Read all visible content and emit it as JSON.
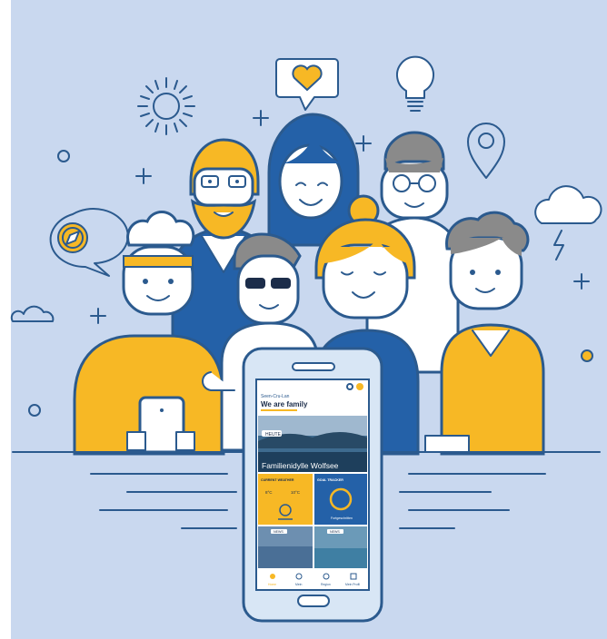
{
  "colors": {
    "background": "#c9d8ef",
    "outline": "#2b5a8e",
    "accent_yellow": "#f7b825",
    "blue": "#2461a8",
    "grey_hair": "#8a8a8a"
  },
  "icons": [
    "sun-icon",
    "heart-speech-bubble-icon",
    "light-bulb-icon",
    "location-pin-icon",
    "compass-speech-bubble-icon",
    "storm-cloud-icon",
    "cloud-icon",
    "plus-icon",
    "circle-icon"
  ],
  "phone": {
    "brand_line": "Seen-Cru-Lan",
    "headline": "We are family",
    "hero_badge": "HEUTE",
    "hero_title": "Familienidylle Wolfsee",
    "card_left_title": "CURRENT WEATHER",
    "weather_left": "8°C",
    "weather_right": "10°C",
    "card_right_title": "GOAL TRACKER",
    "goal_caption": "Fortgeschritten",
    "news_left_badge": "NEWS",
    "news_right_badge": "NEWS",
    "nav": [
      "Home",
      "Mein",
      "Region",
      "Mein Profil"
    ]
  }
}
